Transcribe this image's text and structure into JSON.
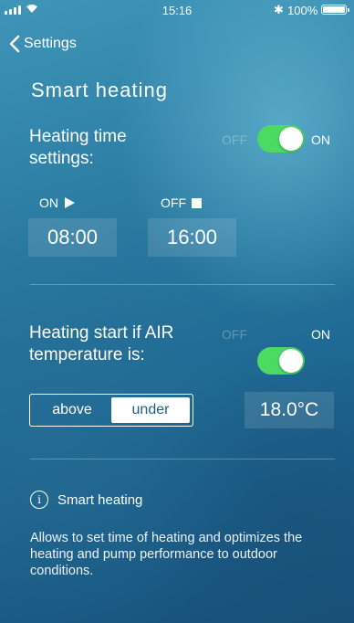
{
  "status_bar": {
    "time": "15:16",
    "battery": "100%"
  },
  "nav": {
    "back_label": "Settings"
  },
  "page": {
    "title": "Smart heating"
  },
  "heating_time": {
    "label": "Heating time settings:",
    "toggle_off": "OFF",
    "toggle_on": "ON",
    "toggle_state": "on",
    "on_label": "ON",
    "off_label": "OFF",
    "on_time": "08:00",
    "off_time": "16:00"
  },
  "air_temperature": {
    "label": "Heating start if AIR temperature is:",
    "toggle_off": "OFF",
    "toggle_on": "ON",
    "toggle_state": "on",
    "segments": [
      "above",
      "under"
    ],
    "selected_segment": "under",
    "value": "18.0°C"
  },
  "info": {
    "title": "Smart heating",
    "description": "Allows to set time of heating and optimizes the heating and pump performance to outdoor conditions."
  },
  "colors": {
    "accent_green": "#4cd964",
    "background": "#2a7aa2"
  }
}
